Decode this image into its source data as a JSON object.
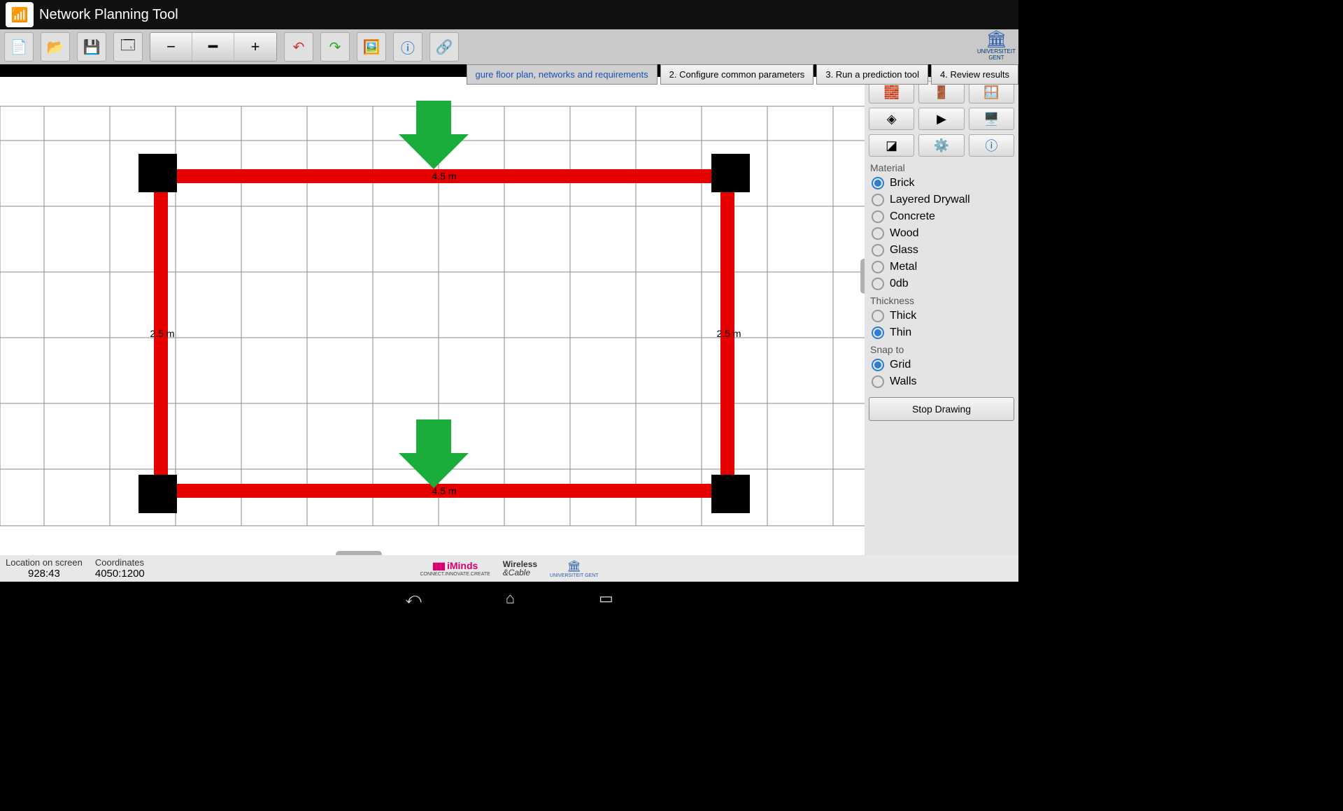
{
  "title": "Network Planning Tool",
  "steps": {
    "s1": "gure floor plan, networks and requirements",
    "s2": "2. Configure common parameters",
    "s3": "3. Run a prediction tool",
    "s4": "4. Review results"
  },
  "side": {
    "material_label": "Material",
    "materials": {
      "brick": "Brick",
      "layered": "Layered Drywall",
      "concrete": "Concrete",
      "wood": "Wood",
      "glass": "Glass",
      "metal": "Metal",
      "zdb": "0db"
    },
    "thickness_label": "Thickness",
    "thickness": {
      "thick": "Thick",
      "thin": "Thin"
    },
    "snap_label": "Snap to",
    "snap": {
      "grid": "Grid",
      "walls": "Walls"
    },
    "stop": "Stop Drawing"
  },
  "canvas": {
    "top_len": "4.5 m",
    "bottom_len": "4.5 m",
    "left_len": "2.5 m",
    "right_len": "2.5 m"
  },
  "status": {
    "loc_label": "Location on screen",
    "loc_val": "928:43",
    "coord_label": "Coordinates",
    "coord_val": "4050:1200"
  },
  "footer": {
    "iminds": "iMinds",
    "iminds_sub": "CONNECT.INNOVATE.CREATE",
    "wc1": "Wireless",
    "wc2": "&Cable",
    "uni": "UNIVERSITEIT GENT"
  },
  "uni": {
    "line1": "UNIVERSITEIT",
    "line2": "GENT"
  }
}
